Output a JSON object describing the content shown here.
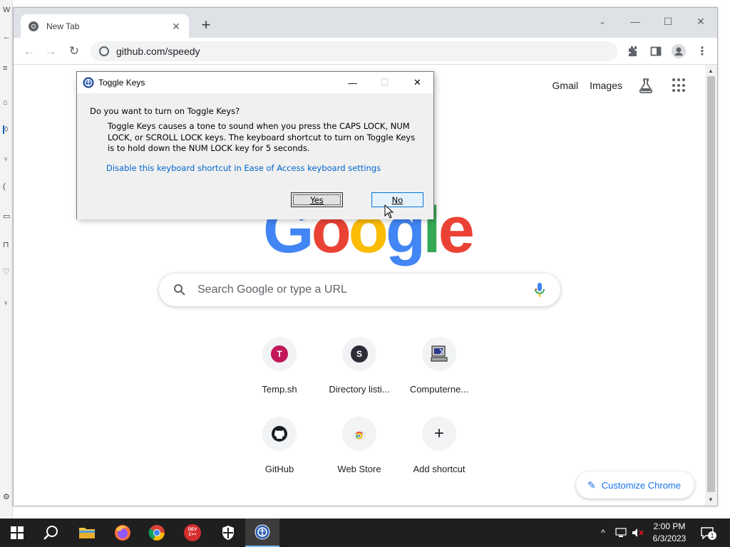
{
  "browser": {
    "tab_title": "New Tab",
    "url": "github.com/speedy",
    "window_controls": {
      "minimize": "—",
      "maximize": "☐",
      "close": "✕"
    }
  },
  "newtab": {
    "top_links": {
      "gmail": "Gmail",
      "images": "Images"
    },
    "logo_letters": [
      "G",
      "o",
      "o",
      "g",
      "l",
      "e"
    ],
    "logo_colors": [
      "#4285f4",
      "#ea4335",
      "#fbbc05",
      "#4285f4",
      "#34a853",
      "#ea4335"
    ],
    "search_placeholder": "Search Google or type a URL",
    "shortcuts": [
      {
        "label": "Temp.sh",
        "letter": "T",
        "color": "#c2185b"
      },
      {
        "label": "Directory listi...",
        "letter": "S",
        "color": "#2d2d3a"
      },
      {
        "label": "Computerne...",
        "icon": "computer-icon"
      },
      {
        "label": "GitHub",
        "icon": "github-icon"
      },
      {
        "label": "Web Store",
        "icon": "chrome-web-store-icon"
      },
      {
        "label": "Add shortcut",
        "icon": "plus-icon"
      }
    ],
    "customize_label": "Customize Chrome"
  },
  "dialog": {
    "title": "Toggle Keys",
    "heading": "Do you want to turn on Toggle Keys?",
    "body": "Toggle Keys causes a tone to sound when you press the CAPS LOCK, NUM LOCK, or SCROLL LOCK keys.  The keyboard shortcut to turn on Toggle Keys is to hold down the NUM LOCK key for 5 seconds.",
    "link": "Disable this keyboard shortcut in Ease of Access keyboard settings",
    "yes_label": "Yes",
    "no_label": "No"
  },
  "taskbar": {
    "time": "2:00 PM",
    "date": "6/3/2023",
    "notification_count": "1",
    "dev_label": "DEV C++"
  },
  "colors": {
    "accent": "#1a73e8",
    "taskbar_bg": "#1f1f1f",
    "dialog_bg": "#f0f0f0"
  }
}
